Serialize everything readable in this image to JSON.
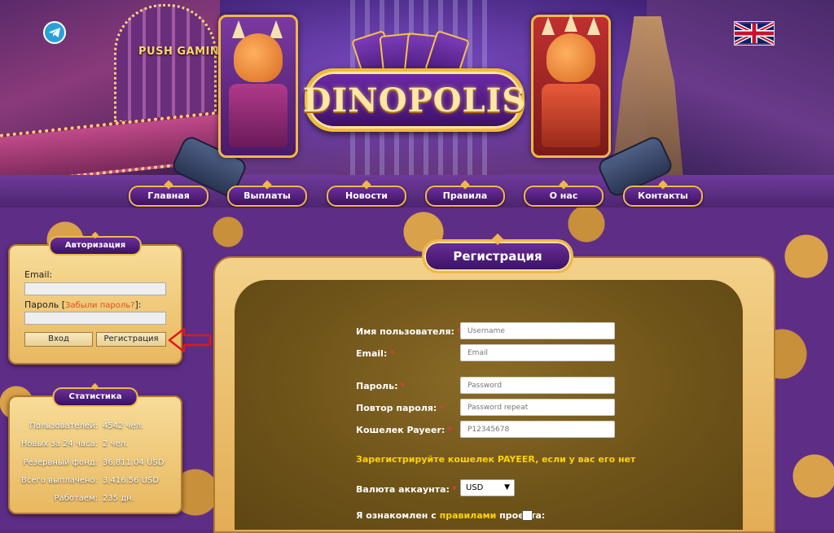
{
  "header": {
    "logo_text": "DINOPOLIS",
    "banner_text": "PUSH GAMING"
  },
  "nav": [
    {
      "label": "Главная"
    },
    {
      "label": "Выплаты"
    },
    {
      "label": "Новости"
    },
    {
      "label": "Правила"
    },
    {
      "label": "О нас"
    },
    {
      "label": "Контакты"
    }
  ],
  "icons": {
    "social": "telegram-icon",
    "language": "uk-flag-icon"
  },
  "auth": {
    "title": "Авторизация",
    "email_label": "Email:",
    "password_label_prefix": "Пароль [",
    "forgot_link": "Забыли пароль?",
    "password_label_suffix": "]:",
    "login_button": "Вход",
    "register_button": "Регистрация"
  },
  "stats": {
    "title": "Статистика",
    "rows": [
      {
        "key": "Пользователей:",
        "value": "4542 чел."
      },
      {
        "key": "Новых за 24 часа:",
        "value": "2 чел."
      },
      {
        "key": "Резервный фонд:",
        "value": "36,811.04 USD"
      },
      {
        "key": "Всего выплачено:",
        "value": "3,416.56 USD"
      },
      {
        "key": "Работаем:",
        "value": "235 дн."
      }
    ]
  },
  "registration": {
    "title": "Регистрация",
    "fields": [
      {
        "label": "Имя пользователя:",
        "placeholder": "Username"
      },
      {
        "label": "Email:",
        "placeholder": "Email"
      },
      {
        "label": "Пароль:",
        "placeholder": "Password"
      },
      {
        "label": "Повтор пароля:",
        "placeholder": "Password repeat"
      },
      {
        "label": "Кошелек Payeer:",
        "placeholder": "P12345678"
      }
    ],
    "payeer_link": "Зарегистрируйте кошелек PAYEER, если у вас его нет",
    "currency_label": "Валюта аккаунта:",
    "currency_value": "USD",
    "agree_prefix": "Я ознакомлен с ",
    "agree_link": "правилами",
    "agree_suffix": " проекта:"
  },
  "colors": {
    "accent_gold": "#f0b84a",
    "nav_purple": "#4d1a78",
    "link_yellow": "#ffd400",
    "required_red": "#e04040",
    "forgot_orange": "#d8531e"
  }
}
